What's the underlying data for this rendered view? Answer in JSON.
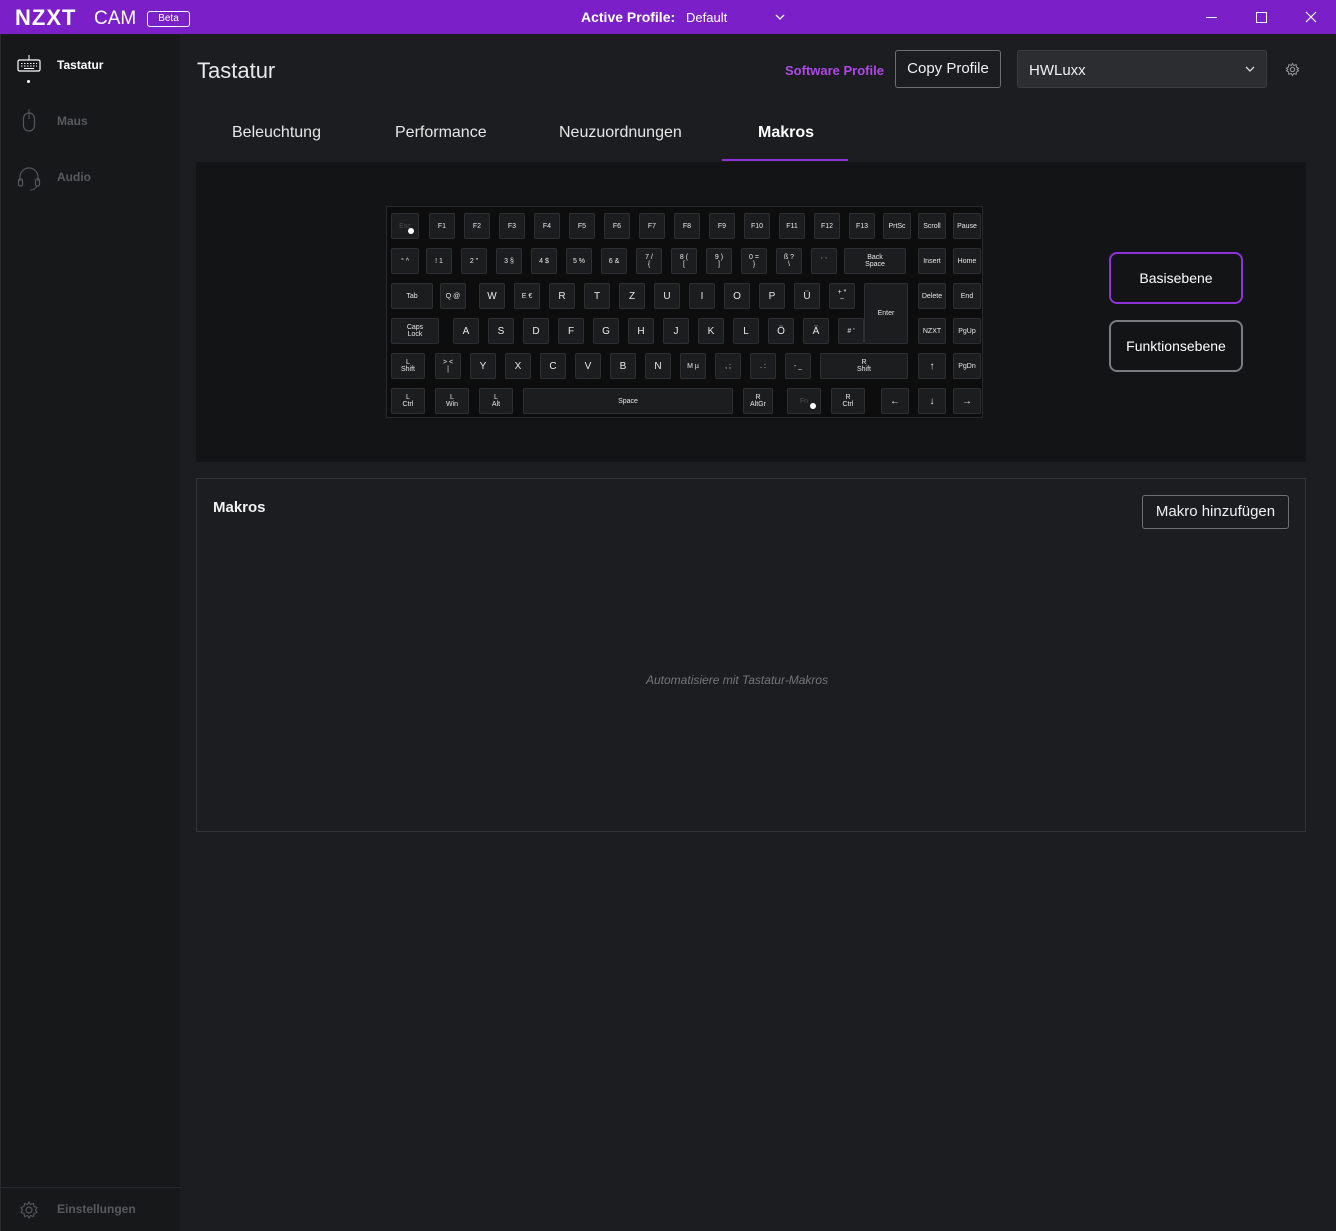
{
  "titlebar": {
    "brand": "NZXT",
    "app": "CAM",
    "badge": "Beta",
    "active_profile_label": "Active Profile:",
    "active_profile_value": "Default",
    "bg_color": "#7b1fc8"
  },
  "sidebar": {
    "items": [
      {
        "label": "Tastatur",
        "icon": "keyboard-icon",
        "active": true
      },
      {
        "label": "Maus",
        "icon": "mouse-icon",
        "active": false
      },
      {
        "label": "Audio",
        "icon": "headset-icon",
        "active": false
      }
    ],
    "settings_label": "Einstellungen"
  },
  "header": {
    "title": "Tastatur",
    "software_profile": "Software Profile",
    "copy_profile": "Copy Profile",
    "profile_select": "HWLuxx"
  },
  "tabs": [
    {
      "label": "Beleuchtung",
      "active": false
    },
    {
      "label": "Performance",
      "active": false
    },
    {
      "label": "Neuzuordnungen",
      "active": false
    },
    {
      "label": "Makros",
      "active": true
    }
  ],
  "keyboard": {
    "rows": [
      [
        "Esc",
        "F1",
        "F2",
        "F3",
        "F4",
        "F5",
        "F6",
        "F7",
        "F8",
        "F9",
        "F10",
        "F11",
        "F12",
        "F13",
        "PrtSc",
        "Scroll",
        "Pause"
      ],
      [
        "°  ^",
        "!  1",
        "2  \"",
        "3  §",
        "4  $",
        "5  %",
        "6  &",
        "7  /\n{",
        "8  (\n[",
        "9  )\n]",
        "0  =\n}",
        "ß  ?\n\\",
        "´  `",
        "Back\nSpace",
        "Insert",
        "Home"
      ],
      [
        "Tab",
        "Q  @",
        "W",
        "E  €",
        "R",
        "T",
        "Z",
        "U",
        "I",
        "O",
        "P",
        "Ü",
        "+  *\n~",
        "Enter",
        "Delete",
        "End"
      ],
      [
        "Caps\nLock",
        "A",
        "S",
        "D",
        "F",
        "G",
        "H",
        "J",
        "K",
        "L",
        "Ö",
        "Ä",
        "#  '",
        "NZXT",
        "PgUp"
      ],
      [
        "L\nShift",
        "> <\n|",
        "Y",
        "X",
        "C",
        "V",
        "B",
        "N",
        "M  µ",
        ",  ;",
        ".  :",
        "-  _",
        "R\nShift",
        "↑",
        "PgDn"
      ],
      [
        "L\nCtrl",
        "L\nWin",
        "L\nAlt",
        "Space",
        "R\nAltGr",
        "Fn",
        "R\nCtrl",
        "←",
        "↓",
        "→"
      ]
    ]
  },
  "layers": {
    "base": "Basisebene",
    "function": "Funktionsebene"
  },
  "macros": {
    "title": "Makros",
    "add_button": "Makro hinzufügen",
    "empty_text": "Automatisiere mit Tastatur-Makros"
  },
  "colors": {
    "accent": "#8f32d9",
    "software_profile_text": "#b048e6",
    "background": "#1c1d20",
    "sidebar": "#17181a"
  }
}
